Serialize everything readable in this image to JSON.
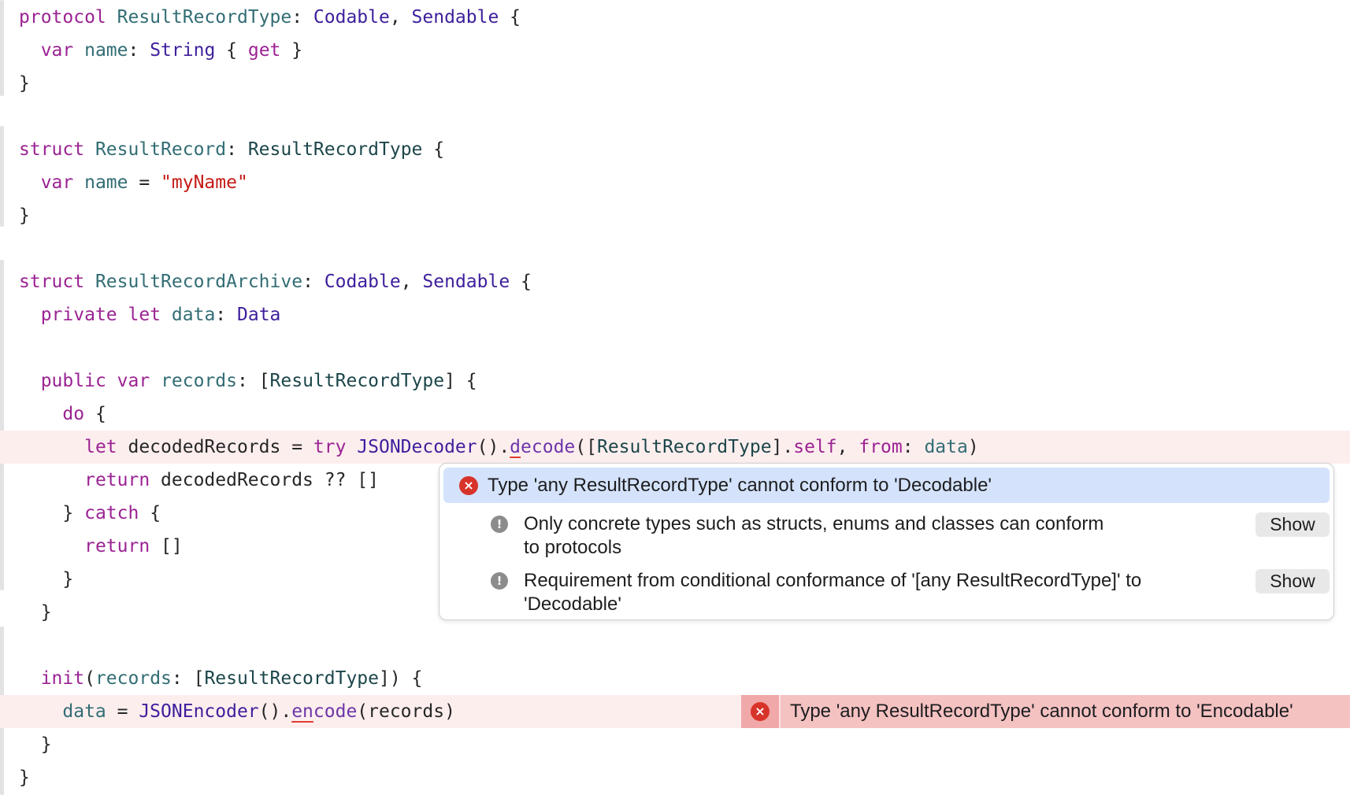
{
  "code": [
    [
      {
        "t": "protocol",
        "c": "kw"
      },
      {
        "t": " ",
        "c": "pl"
      },
      {
        "t": "ResultRecordType",
        "c": "id"
      },
      {
        "t": ": ",
        "c": "pl"
      },
      {
        "t": "Codable",
        "c": "ty"
      },
      {
        "t": ", ",
        "c": "pl"
      },
      {
        "t": "Sendable",
        "c": "ty"
      },
      {
        "t": " {",
        "c": "pl"
      }
    ],
    [
      {
        "t": "  ",
        "c": "pl"
      },
      {
        "t": "var",
        "c": "kw"
      },
      {
        "t": " ",
        "c": "pl"
      },
      {
        "t": "name",
        "c": "id"
      },
      {
        "t": ": ",
        "c": "pl"
      },
      {
        "t": "String",
        "c": "ty"
      },
      {
        "t": " { ",
        "c": "pl"
      },
      {
        "t": "get",
        "c": "kw"
      },
      {
        "t": " }",
        "c": "pl"
      }
    ],
    [
      {
        "t": "}",
        "c": "pl"
      }
    ],
    [],
    [
      {
        "t": "struct",
        "c": "kw"
      },
      {
        "t": " ",
        "c": "pl"
      },
      {
        "t": "ResultRecord",
        "c": "id"
      },
      {
        "t": ": ",
        "c": "pl"
      },
      {
        "t": "ResultRecordType",
        "c": "tyu"
      },
      {
        "t": " {",
        "c": "pl"
      }
    ],
    [
      {
        "t": "  ",
        "c": "pl"
      },
      {
        "t": "var",
        "c": "kw"
      },
      {
        "t": " ",
        "c": "pl"
      },
      {
        "t": "name",
        "c": "id"
      },
      {
        "t": " = ",
        "c": "pl"
      },
      {
        "t": "\"myName\"",
        "c": "str"
      }
    ],
    [
      {
        "t": "}",
        "c": "pl"
      }
    ],
    [],
    [
      {
        "t": "struct",
        "c": "kw"
      },
      {
        "t": " ",
        "c": "pl"
      },
      {
        "t": "ResultRecordArchive",
        "c": "id"
      },
      {
        "t": ": ",
        "c": "pl"
      },
      {
        "t": "Codable",
        "c": "ty"
      },
      {
        "t": ", ",
        "c": "pl"
      },
      {
        "t": "Sendable",
        "c": "ty"
      },
      {
        "t": " {",
        "c": "pl"
      }
    ],
    [
      {
        "t": "  ",
        "c": "pl"
      },
      {
        "t": "private",
        "c": "kw"
      },
      {
        "t": " ",
        "c": "pl"
      },
      {
        "t": "let",
        "c": "kw"
      },
      {
        "t": " ",
        "c": "pl"
      },
      {
        "t": "data",
        "c": "id"
      },
      {
        "t": ": ",
        "c": "pl"
      },
      {
        "t": "Data",
        "c": "ty"
      }
    ],
    [],
    [
      {
        "t": "  ",
        "c": "pl"
      },
      {
        "t": "public",
        "c": "kw"
      },
      {
        "t": " ",
        "c": "pl"
      },
      {
        "t": "var",
        "c": "kw"
      },
      {
        "t": " ",
        "c": "pl"
      },
      {
        "t": "records",
        "c": "id"
      },
      {
        "t": ": [",
        "c": "pl"
      },
      {
        "t": "ResultRecordType",
        "c": "tyu"
      },
      {
        "t": "] {",
        "c": "pl"
      }
    ],
    [
      {
        "t": "    ",
        "c": "pl"
      },
      {
        "t": "do",
        "c": "kw"
      },
      {
        "t": " {",
        "c": "pl"
      }
    ],
    [
      {
        "t": "      ",
        "c": "pl"
      },
      {
        "t": "let",
        "c": "kw"
      },
      {
        "t": " decodedRecords = ",
        "c": "pl"
      },
      {
        "t": "try",
        "c": "kw"
      },
      {
        "t": " ",
        "c": "pl"
      },
      {
        "t": "JSONDecoder",
        "c": "ty"
      },
      {
        "t": "().",
        "c": "pl"
      },
      {
        "t": "d",
        "c": "meth err-under"
      },
      {
        "t": "ecode",
        "c": "meth"
      },
      {
        "t": "([",
        "c": "pl"
      },
      {
        "t": "ResultRecordType",
        "c": "tyu"
      },
      {
        "t": "].",
        "c": "pl"
      },
      {
        "t": "self",
        "c": "kw"
      },
      {
        "t": ", ",
        "c": "pl"
      },
      {
        "t": "from",
        "c": "kw"
      },
      {
        "t": ": ",
        "c": "pl"
      },
      {
        "t": "data",
        "c": "id"
      },
      {
        "t": ")",
        "c": "pl"
      }
    ],
    [
      {
        "t": "      ",
        "c": "pl"
      },
      {
        "t": "return",
        "c": "kw"
      },
      {
        "t": " decodedRecords ?? []",
        "c": "pl"
      }
    ],
    [
      {
        "t": "    } ",
        "c": "pl"
      },
      {
        "t": "catch",
        "c": "kw"
      },
      {
        "t": " {",
        "c": "pl"
      }
    ],
    [
      {
        "t": "      ",
        "c": "pl"
      },
      {
        "t": "return",
        "c": "kw"
      },
      {
        "t": " []",
        "c": "pl"
      }
    ],
    [
      {
        "t": "    }",
        "c": "pl"
      }
    ],
    [
      {
        "t": "  }",
        "c": "pl"
      }
    ],
    [],
    [
      {
        "t": "  ",
        "c": "pl"
      },
      {
        "t": "init",
        "c": "kw"
      },
      {
        "t": "(",
        "c": "pl"
      },
      {
        "t": "records",
        "c": "id"
      },
      {
        "t": ": [",
        "c": "pl"
      },
      {
        "t": "ResultRecordType",
        "c": "tyu"
      },
      {
        "t": "]) {",
        "c": "pl"
      }
    ],
    [
      {
        "t": "    ",
        "c": "pl"
      },
      {
        "t": "data",
        "c": "id"
      },
      {
        "t": " = ",
        "c": "pl"
      },
      {
        "t": "JSONEncoder",
        "c": "ty"
      },
      {
        "t": "().",
        "c": "pl"
      },
      {
        "t": "en",
        "c": "meth err-under"
      },
      {
        "t": "code",
        "c": "meth"
      },
      {
        "t": "(records)",
        "c": "pl"
      }
    ],
    [
      {
        "t": "  }",
        "c": "pl"
      }
    ],
    [
      {
        "t": "}",
        "c": "pl"
      }
    ]
  ],
  "error_lines": [
    13,
    21
  ],
  "popover": {
    "primary_error": "Type 'any ResultRecordType' cannot conform to 'Decodable'",
    "notes": [
      {
        "line1": "Only concrete types such as structs, enums and classes can conform",
        "line2": "to protocols",
        "button": "Show"
      },
      {
        "line1": "Requirement from conditional conformance of '[any ResultRecordType]' to",
        "line2": "'Decodable'",
        "button": "Show"
      }
    ]
  },
  "inline_error": {
    "text": "Type 'any ResultRecordType' cannot conform to 'Encodable'"
  },
  "colors": {
    "keyword": "#9b2393",
    "type": "#3e1f9c",
    "user_type": "#1c464a",
    "identifier": "#326d74",
    "method": "#6c36a9",
    "string": "#c41a16",
    "error_red": "#d8332a",
    "error_line_bg": "#fdeeee",
    "selection_blue": "#d4e3fb"
  },
  "icons": {
    "error": "error-x-circle-icon",
    "note": "exclamation-circle-icon"
  }
}
